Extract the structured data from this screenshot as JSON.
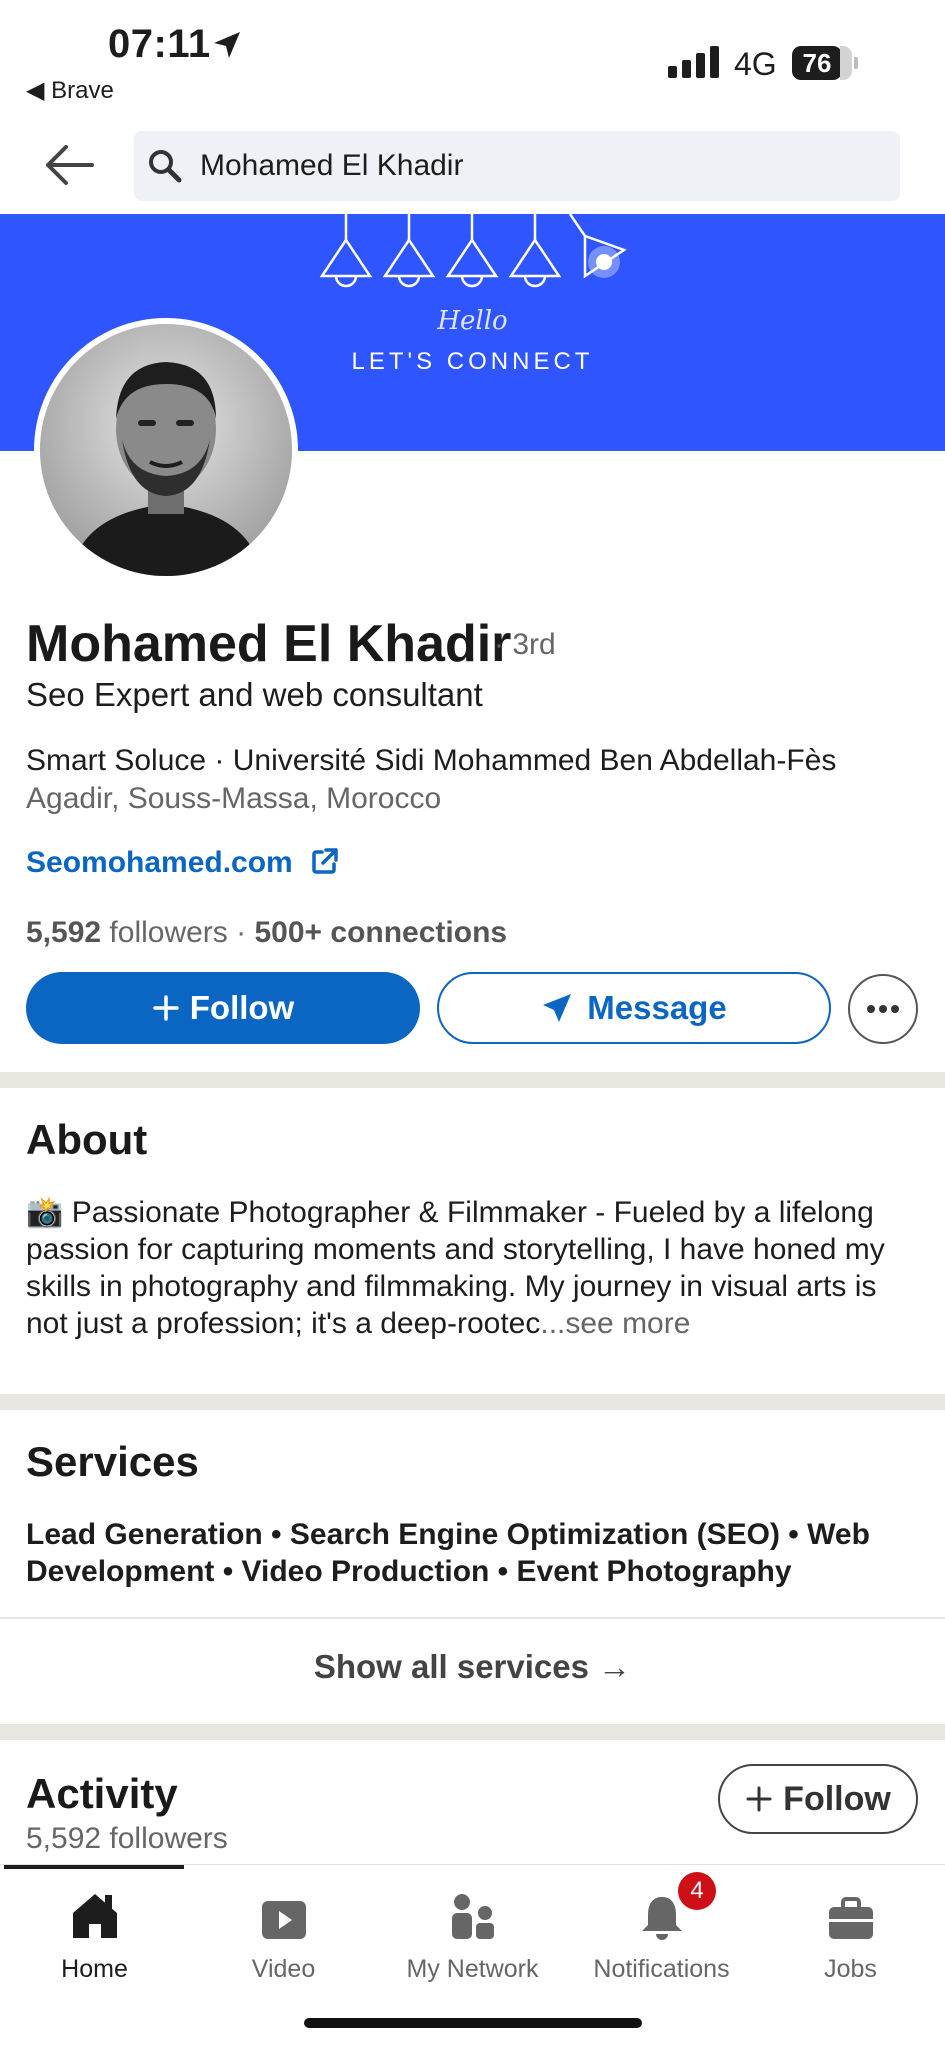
{
  "status_bar": {
    "time": "07:11",
    "back_app": "◀ Brave",
    "network": "4G",
    "battery": "76"
  },
  "search": {
    "query": "Mohamed El Khadir"
  },
  "banner": {
    "hello": "Hello",
    "connect": "LET'S CONNECT",
    "color": "#2f55ff"
  },
  "profile": {
    "name": "Mohamed El Khadir",
    "degree": "· 3rd",
    "headline": "Seo Expert and web consultant",
    "education": "Smart Soluce · Université Sidi Mohammed Ben Abdellah-Fès",
    "location": "Agadir, Souss-Massa, Morocco",
    "website": "Seomohamed.com",
    "followers_count": "5,592",
    "followers_label": "followers",
    "separator": "·",
    "connections": "500+ connections"
  },
  "actions": {
    "follow": "Follow",
    "message": "Message"
  },
  "about": {
    "title": "About",
    "emoji": "📸",
    "text": "Passionate Photographer & Filmmaker - Fueled by a lifelong passion for capturing moments and storytelling, I have honed my skills in photography and filmmaking. My journey in visual arts is not just a profession; it's a deep-rootec",
    "see_more": "...see more"
  },
  "services": {
    "title": "Services",
    "list": "Lead Generation • Search Engine Optimization (SEO) • Web Development • Video Production • Event Photography",
    "show_all": "Show all services →"
  },
  "activity": {
    "title": "Activity",
    "followers": "5,592 followers",
    "follow": "Follow"
  },
  "nav": {
    "items": [
      {
        "label": "Home",
        "icon": "home-icon"
      },
      {
        "label": "Video",
        "icon": "video-icon"
      },
      {
        "label": "My Network",
        "icon": "network-icon"
      },
      {
        "label": "Notifications",
        "icon": "bell-icon"
      },
      {
        "label": "Jobs",
        "icon": "briefcase-icon"
      }
    ],
    "notification_badge": "4"
  },
  "colors": {
    "primary": "#0a66c2",
    "badge": "#cc1016"
  }
}
